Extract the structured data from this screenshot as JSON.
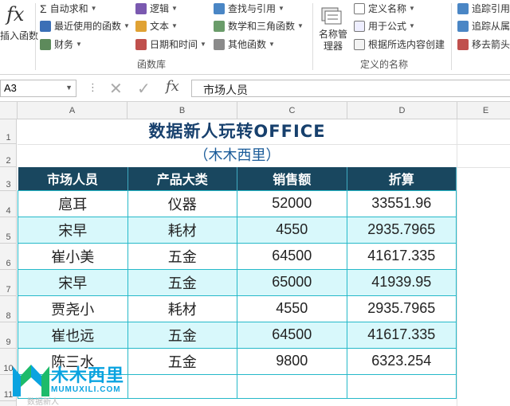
{
  "ribbon": {
    "insert_function": "插入函数",
    "insert_function_fx": "fx",
    "autosum": "自动求和",
    "recent": "最近使用的函数",
    "financial": "财务",
    "logical": "逻辑",
    "text": "文本",
    "datetime": "日期和时间",
    "lookup": "查找与引用",
    "math": "数学和三角函数",
    "other": "其他函数",
    "library_group": "函数库",
    "name_manager": "名称管理器",
    "define_name": "定义名称",
    "use_in_formula": "用于公式",
    "create_from_selection": "根据所选内容创建",
    "names_group": "定义的名称",
    "trace_precedents": "追踪引用",
    "trace_dependents": "追踪从属",
    "remove_arrows": "移去箭头"
  },
  "formula_bar": {
    "name_box": "A3",
    "fx": "fx",
    "value": "市场人员"
  },
  "columns": [
    "A",
    "B",
    "C",
    "D",
    "E"
  ],
  "rows": [
    "1",
    "2",
    "3",
    "4",
    "5",
    "6",
    "7",
    "8",
    "9",
    "10",
    "11"
  ],
  "sheet": {
    "title": "数据新人玩转OFFICE",
    "subtitle": "（木木西里）",
    "headers": [
      "市场人员",
      "产品大类",
      "销售额",
      "折算"
    ],
    "records": [
      [
        "扈耳",
        "仪器",
        "52000",
        "33551.96"
      ],
      [
        "宋早",
        "耗材",
        "4550",
        "2935.7965"
      ],
      [
        "崔小美",
        "五金",
        "64500",
        "41617.335"
      ],
      [
        "宋早",
        "五金",
        "65000",
        "41939.95"
      ],
      [
        "贾尧小",
        "耗材",
        "4550",
        "2935.7965"
      ],
      [
        "崔也远",
        "五金",
        "64500",
        "41617.335"
      ],
      [
        "陈三水",
        "五金",
        "9800",
        "6323.254"
      ]
    ]
  },
  "watermark": {
    "cn": "木木西里",
    "en": "MUMUXILI.COM",
    "sub": "数据新人"
  },
  "colors": {
    "header_fill": "#19475f",
    "alt_row_fill": "#d8f8fb",
    "border": "#26b9c9",
    "title": "#17406d"
  }
}
